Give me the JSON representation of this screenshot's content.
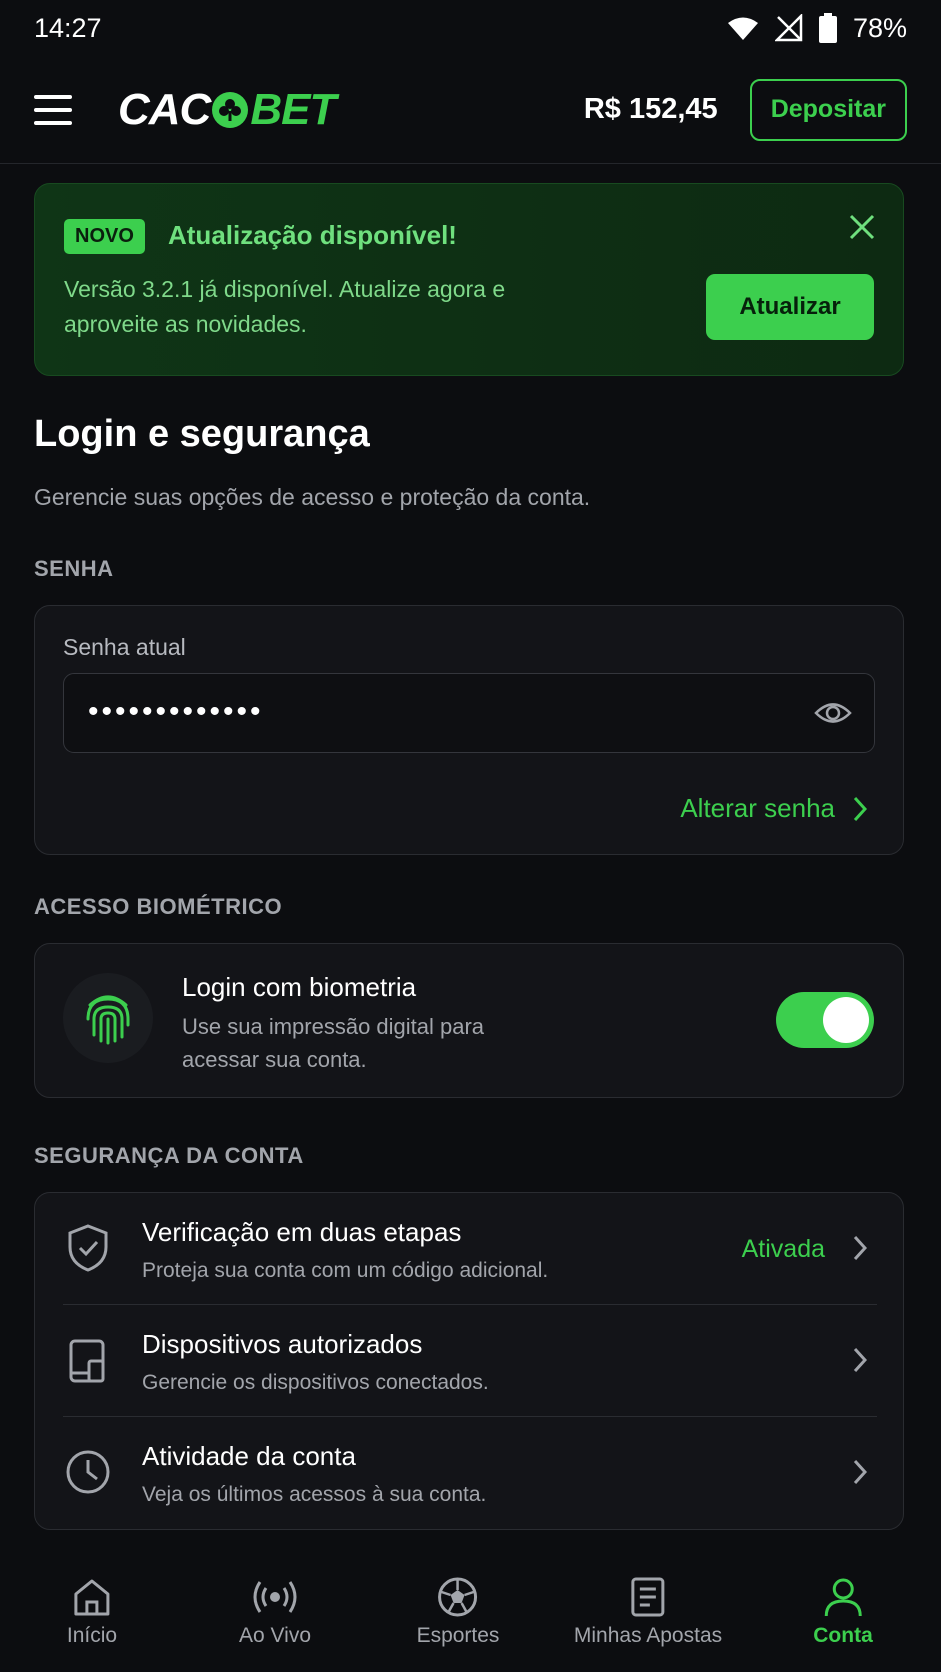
{
  "status_bar": {
    "time": "14:27",
    "battery": "78%",
    "icons": [
      "wifi-icon",
      "no-signal-icon",
      "battery-icon"
    ]
  },
  "header": {
    "logo_left": "CAC",
    "logo_right": "BET",
    "balance": "R$ 152,45",
    "deposit_label": "Depositar"
  },
  "banner": {
    "badge": "NOVO",
    "title": "Atualização disponível!",
    "text": "Versão 3.2.1 já disponível. Atualize agora e aproveite as novidades.",
    "button_label": "Atualizar"
  },
  "page": {
    "title": "Login e segurança",
    "subtitle": "Gerencie suas opções de acesso e proteção da conta."
  },
  "password": {
    "section_label": "SENHA",
    "field_label": "Senha atual",
    "value": "•••••••••••••",
    "change_label": "Alterar senha"
  },
  "biometric": {
    "section_label": "ACESSO BIOMÉTRICO",
    "title": "Login com biometria",
    "description": "Use sua impressão digital para acessar sua conta.",
    "enabled": true
  },
  "security": {
    "section_label": "SEGURANÇA DA CONTA",
    "items": [
      {
        "title": "Verificação em duas etapas",
        "desc": "Proteja sua conta com um código adicional.",
        "status": "Ativada",
        "icon": "shield-check-icon"
      },
      {
        "title": "Dispositivos autorizados",
        "desc": "Gerencie os dispositivos conectados.",
        "status": "",
        "icon": "devices-icon"
      },
      {
        "title": "Atividade da conta",
        "desc": "Veja os últimos acessos à sua conta.",
        "status": "",
        "icon": "clock-icon"
      }
    ]
  },
  "nav": {
    "items": [
      {
        "label": "Início",
        "icon": "home-icon"
      },
      {
        "label": "Ao Vivo",
        "icon": "live-icon"
      },
      {
        "label": "Esportes",
        "icon": "soccer-ball-icon"
      },
      {
        "label": "Minhas Apostas",
        "icon": "bets-ticket-icon"
      },
      {
        "label": "Conta",
        "icon": "user-icon"
      }
    ],
    "active": "Conta"
  },
  "colors": {
    "accent": "#3ccf4e",
    "background": "#0c0d10",
    "card": "#131418"
  }
}
